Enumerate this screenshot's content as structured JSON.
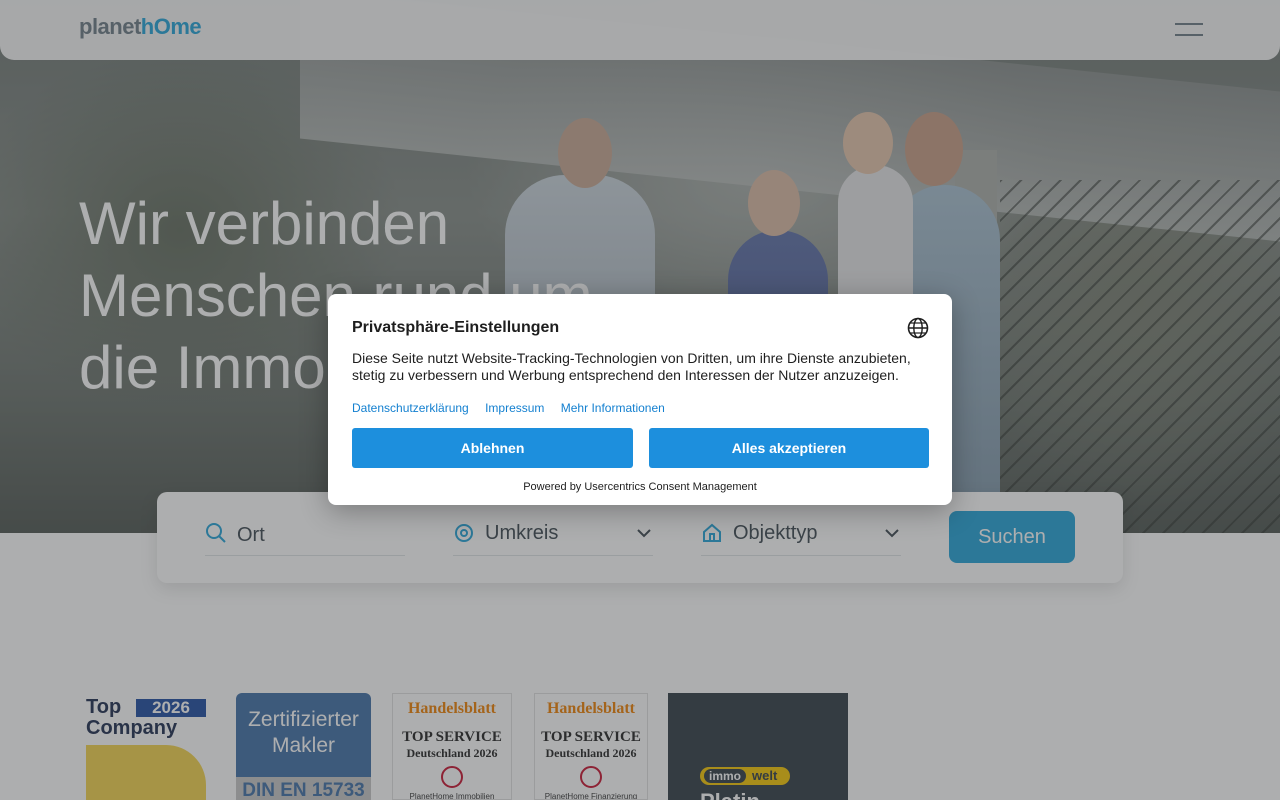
{
  "header": {
    "logo_part1": "planet",
    "logo_part2": "hOme",
    "menu_icon": "hamburger-menu-icon"
  },
  "hero": {
    "headline_line1": "Wir verbinden",
    "headline_line2": "Menschen rund um",
    "headline_line3": "die Immobilie"
  },
  "search": {
    "location_placeholder": "Ort",
    "radius_label": "Umkreis",
    "object_type_label": "Objekttyp",
    "submit_label": "Suchen",
    "icons": {
      "location": "search-icon",
      "radius": "target-icon",
      "object_type": "house-icon",
      "dropdown": "chevron-down-icon"
    }
  },
  "badges": {
    "top_company": {
      "line1": "Top",
      "year": "2026",
      "line2": "Company"
    },
    "certified": {
      "line1": "Zertifizierter",
      "line2": "Makler",
      "norm": "DIN EN 15733"
    },
    "handelsblatt_1": {
      "brand": "Handelsblatt",
      "line1": "TOP SERVICE",
      "line2": "Deutschland 2026",
      "footer": "PlanetHome Immobilien"
    },
    "handelsblatt_2": {
      "brand": "Handelsblatt",
      "line1": "TOP SERVICE",
      "line2": "Deutschland 2026",
      "footer": "PlanetHome Finanzierung"
    },
    "immowelt": {
      "brand_a": "immo",
      "brand_b": "welt",
      "label": "Platin"
    }
  },
  "consent": {
    "title": "Privatsphäre-Einstellungen",
    "body": "Diese Seite nutzt Website-Tracking-Technologien von Dritten, um ihre Dienste anzubieten, stetig zu verbessern und Werbung entsprechend den Interessen der Nutzer anzuzeigen.",
    "links": [
      "Datenschutzerklärung",
      "Impressum",
      "Mehr Informationen"
    ],
    "deny_label": "Ablehnen",
    "accept_label": "Alles akzeptieren",
    "powered_by": "Powered by Usercentrics Consent Management",
    "language_icon": "globe-icon"
  },
  "colors": {
    "brand_blue": "#22a3d8",
    "consent_button": "#1d8fdd",
    "link": "#1480d0"
  }
}
